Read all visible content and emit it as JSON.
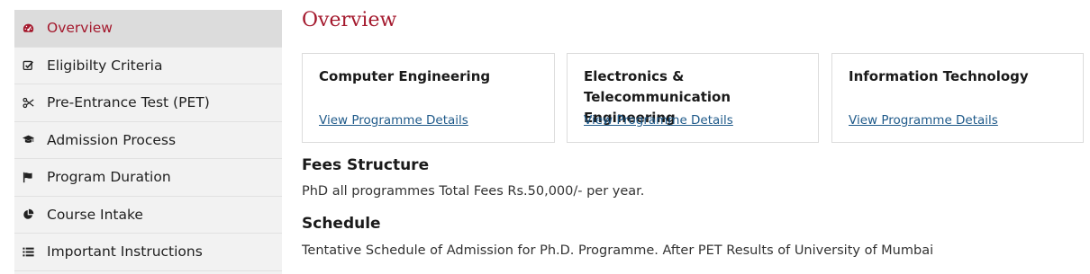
{
  "sidebar": {
    "items": [
      {
        "label": "Overview",
        "icon": "dashboard-icon",
        "active": true
      },
      {
        "label": "Eligibilty Criteria",
        "icon": "checkbox-icon",
        "active": false
      },
      {
        "label": "Pre-Entrance Test (PET)",
        "icon": "scissors-icon",
        "active": false
      },
      {
        "label": "Admission Process",
        "icon": "graduation-cap-icon",
        "active": false
      },
      {
        "label": "Program Duration",
        "icon": "flag-icon",
        "active": false
      },
      {
        "label": "Course Intake",
        "icon": "pie-chart-icon",
        "active": false
      },
      {
        "label": "Important Instructions",
        "icon": "list-icon",
        "active": false
      }
    ]
  },
  "main": {
    "title": "Overview",
    "programmes": [
      {
        "title_line1": "Computer Engineering",
        "title_line2": "",
        "link": "View Programme Details"
      },
      {
        "title_line1": "Electronics &",
        "title_line2": "Telecommunication Engineering",
        "link": "View Programme Details"
      },
      {
        "title_line1": "Information Technology",
        "title_line2": "",
        "link": "View Programme Details"
      }
    ],
    "fees": {
      "heading": "Fees Structure",
      "text": "PhD all programmes Total Fees Rs.50,000/- per year."
    },
    "schedule": {
      "heading": "Schedule",
      "text": "Tentative Schedule of Admission for Ph.D. Programme. After PET Results of University of Mumbai"
    }
  },
  "colors": {
    "accent": "#a4192d",
    "link": "#1f5a8a",
    "sidebar_bg": "#f2f2f2",
    "sidebar_active_bg": "#dcdcdc"
  }
}
